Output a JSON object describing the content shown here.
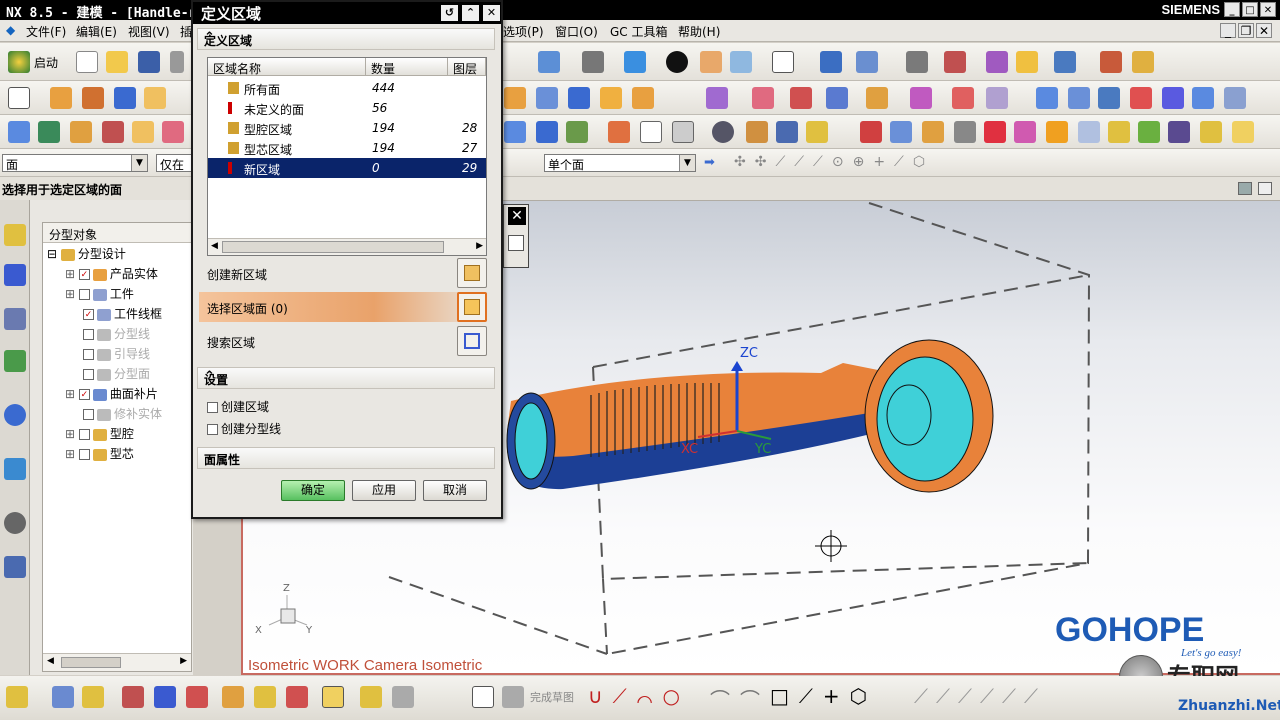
{
  "title": {
    "text": "NX 8.5 - 建模 - [Handle-r",
    "brand": "SIEMENS"
  },
  "menu": {
    "items": [
      "文件(F)",
      "编辑(E)",
      "视图(V)",
      "插",
      "选项(P)",
      "窗口(O)",
      "GC 工具箱",
      "帮助(H)"
    ],
    "start": "启动"
  },
  "filters": {
    "type": "面",
    "scope": "仅在工",
    "selection": "单个面"
  },
  "cue": "选择用于选定区域的面",
  "nav": {
    "header": "分型对象",
    "root": "分型设计",
    "items": [
      {
        "label": "产品实体",
        "checked": true,
        "dim": false
      },
      {
        "label": "工件",
        "checked": false,
        "dim": false
      },
      {
        "label": "工件线框",
        "checked": true,
        "dim": false
      },
      {
        "label": "分型线",
        "checked": false,
        "dim": true
      },
      {
        "label": "引导线",
        "checked": false,
        "dim": true
      },
      {
        "label": "分型面",
        "checked": false,
        "dim": true
      },
      {
        "label": "曲面补片",
        "checked": true,
        "dim": false
      },
      {
        "label": "修补实体",
        "checked": false,
        "dim": true
      },
      {
        "label": "型腔",
        "checked": false,
        "dim": false
      },
      {
        "label": "型芯",
        "checked": false,
        "dim": false
      }
    ]
  },
  "dialog": {
    "title": "定义区域",
    "group1": "定义区域",
    "columns": [
      "区域名称",
      "数量",
      "图层"
    ],
    "rows": [
      {
        "name": "所有面",
        "count": "444",
        "layer": "",
        "selected": false
      },
      {
        "name": "未定义的面",
        "count": "56",
        "layer": "",
        "selected": false
      },
      {
        "name": "型腔区域",
        "count": "194",
        "layer": "28",
        "selected": false
      },
      {
        "name": "型芯区域",
        "count": "194",
        "layer": "27",
        "selected": false
      },
      {
        "name": "新区域",
        "count": "0",
        "layer": "29",
        "selected": true
      }
    ],
    "create_region": "创建新区域",
    "select_faces": "选择区域面 (0)",
    "search_region": "搜索区域",
    "settings": "设置",
    "opt_create_region": "创建区域",
    "opt_create_parting": "创建分型线",
    "face_props": "面属性",
    "ok": "确定",
    "apply": "应用",
    "cancel": "取消"
  },
  "viewport": {
    "label": "Isometric WORK Camera Isometric",
    "axes": {
      "zc": "ZC",
      "xc": "XC",
      "yc": "YC"
    },
    "triad": {
      "z": "Z",
      "x": "X",
      "y": "Y"
    },
    "watermark": "GOHOPE",
    "watermark_sub": "Let's go easy!",
    "site": "Zhuanzhi.Net",
    "site_cn": "专职网"
  },
  "bottom": {
    "sketch": "完成草图"
  },
  "colors": {
    "accent": "#0a246a",
    "part_orange": "#e8823a",
    "part_blue": "#1c3f95",
    "cyan": "#3fd0d8"
  }
}
